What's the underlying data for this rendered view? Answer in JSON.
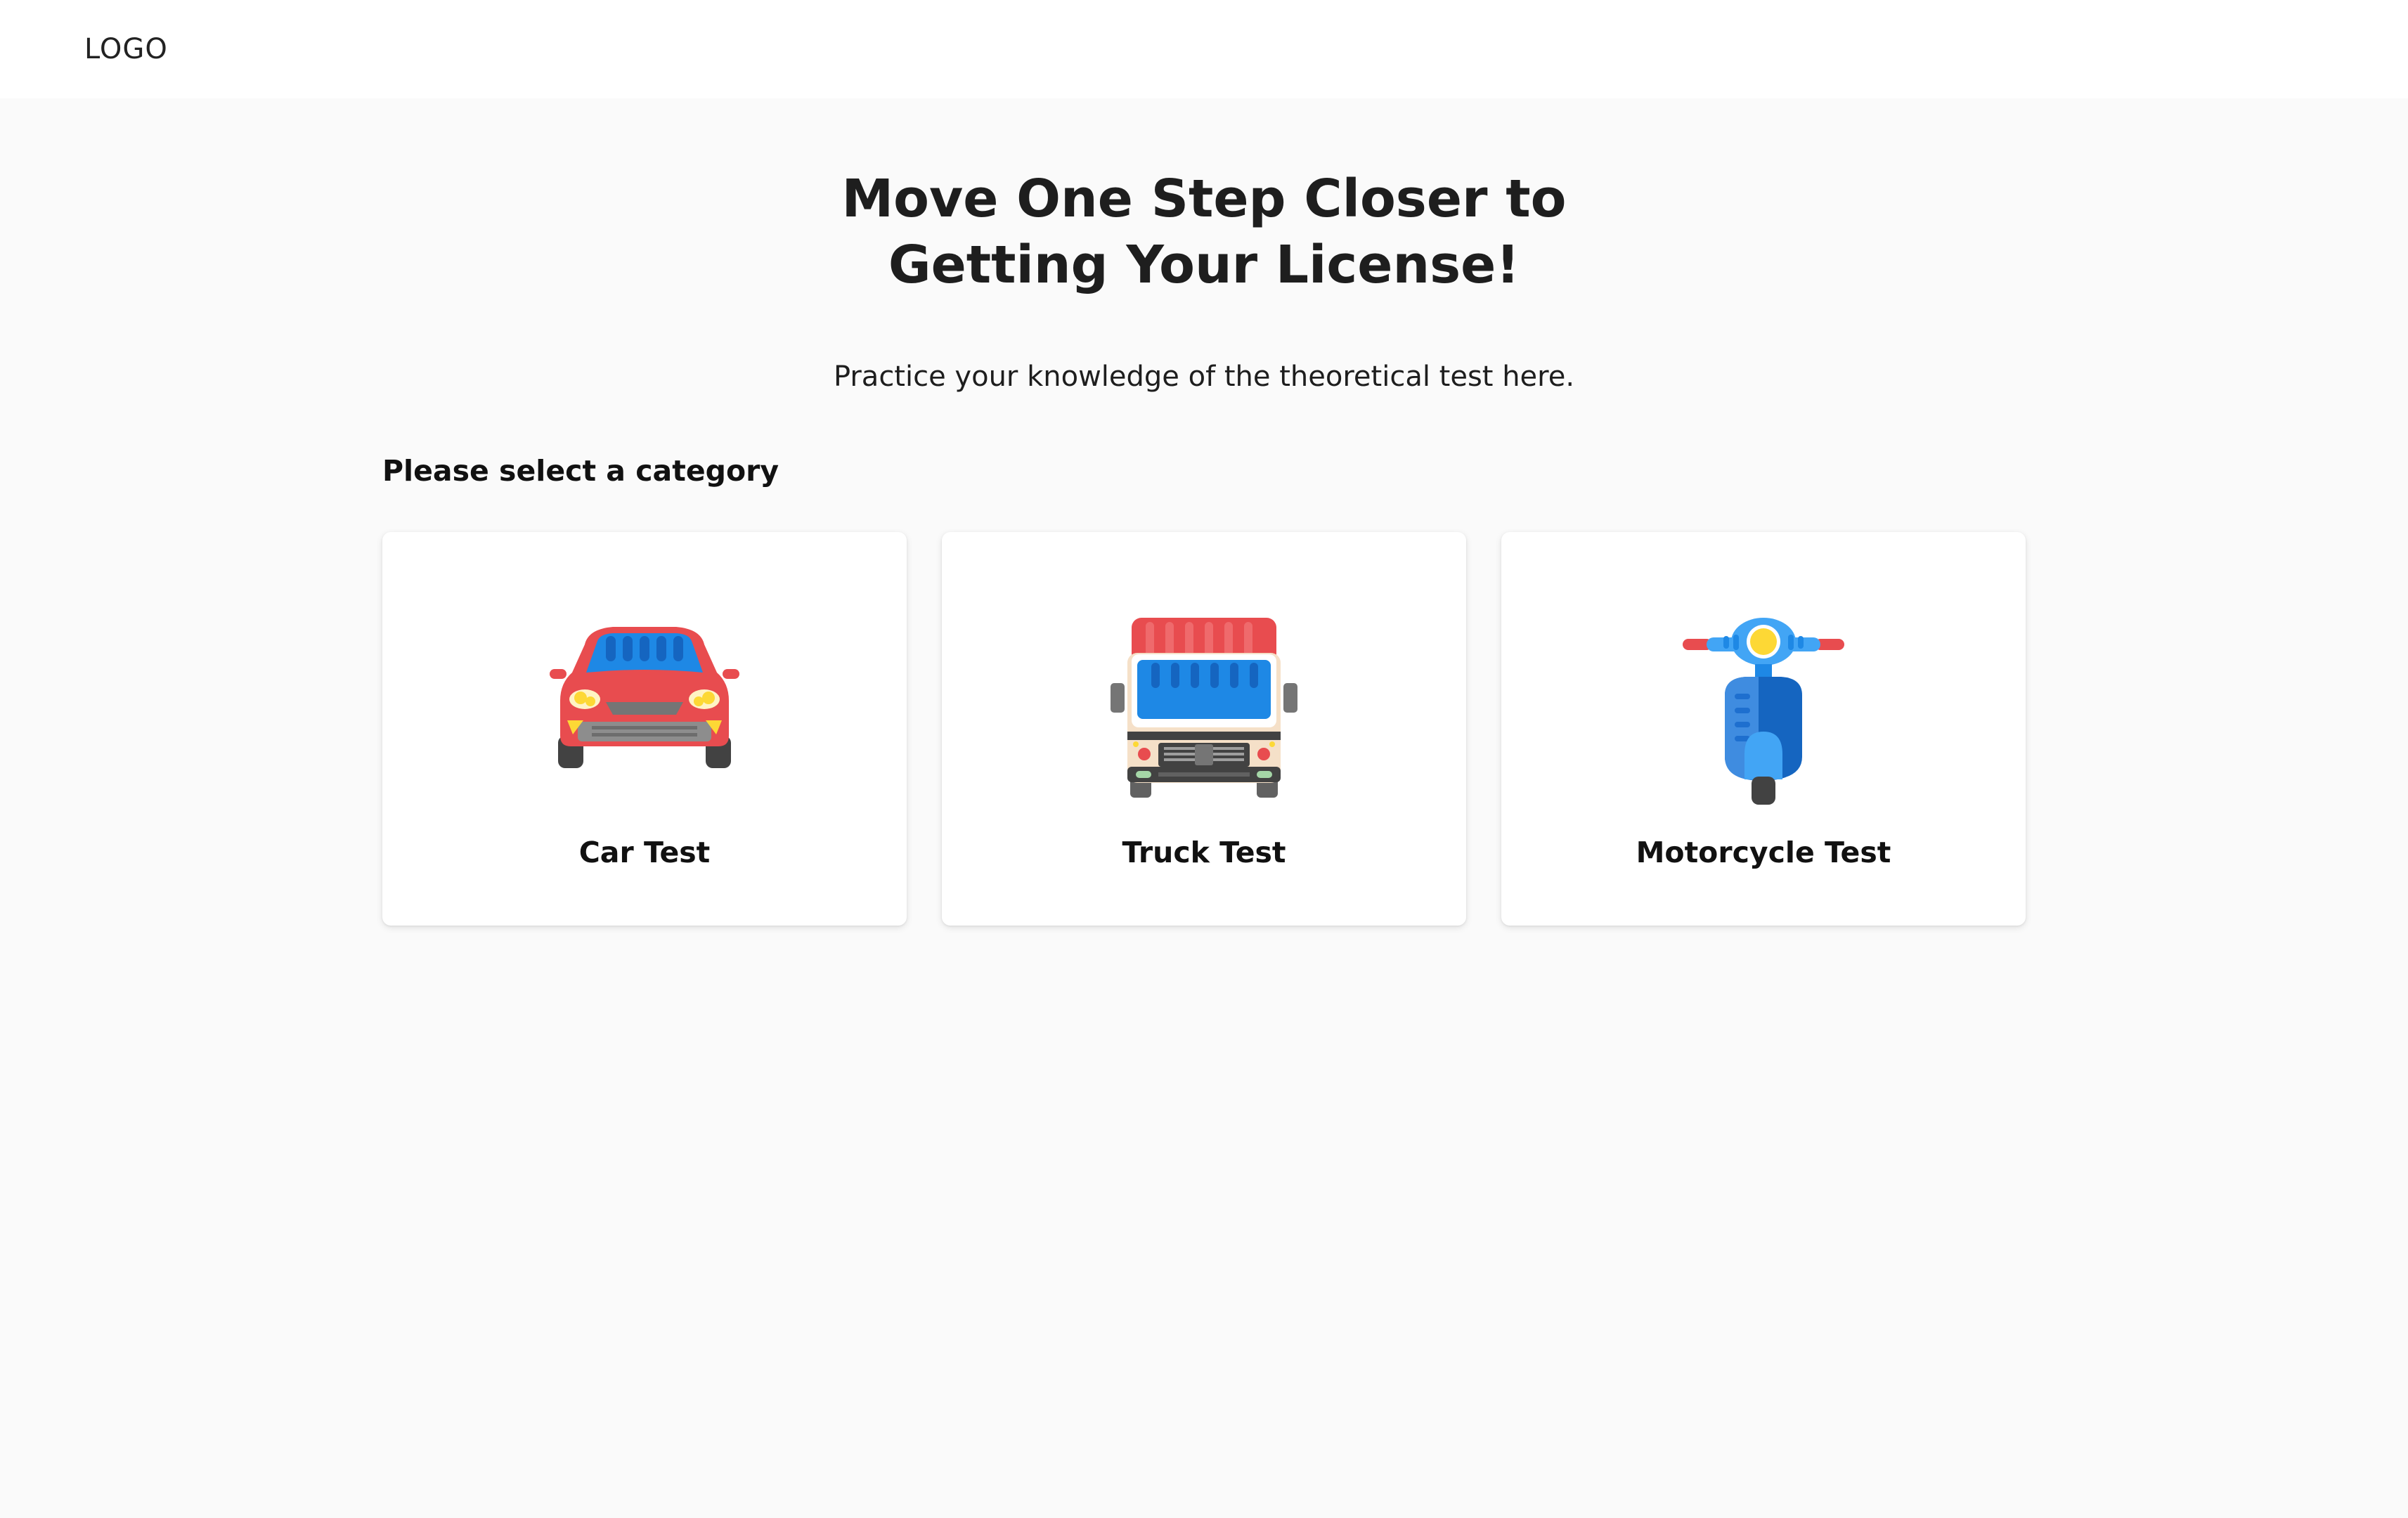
{
  "header": {
    "logo_text": "LOGO"
  },
  "hero": {
    "title_line1": "Move One Step Closer to",
    "title_line2": "Getting Your License!",
    "subtitle": "Practice your knowledge of the theoretical test here."
  },
  "categories": {
    "label": "Please select a category",
    "items": [
      {
        "title": "Car Test",
        "icon": "car-icon"
      },
      {
        "title": "Truck Test",
        "icon": "truck-icon"
      },
      {
        "title": "Motorcycle Test",
        "icon": "scooter-icon"
      }
    ]
  },
  "colors": {
    "background": "#fafafa",
    "header_background": "#ffffff",
    "card_background": "#ffffff",
    "vehicle_red": "#e84c4f",
    "vehicle_blue": "#1e88e5",
    "vehicle_light_blue": "#42a5f5",
    "vehicle_dark": "#424242",
    "headlight_yellow": "#fdd835"
  }
}
